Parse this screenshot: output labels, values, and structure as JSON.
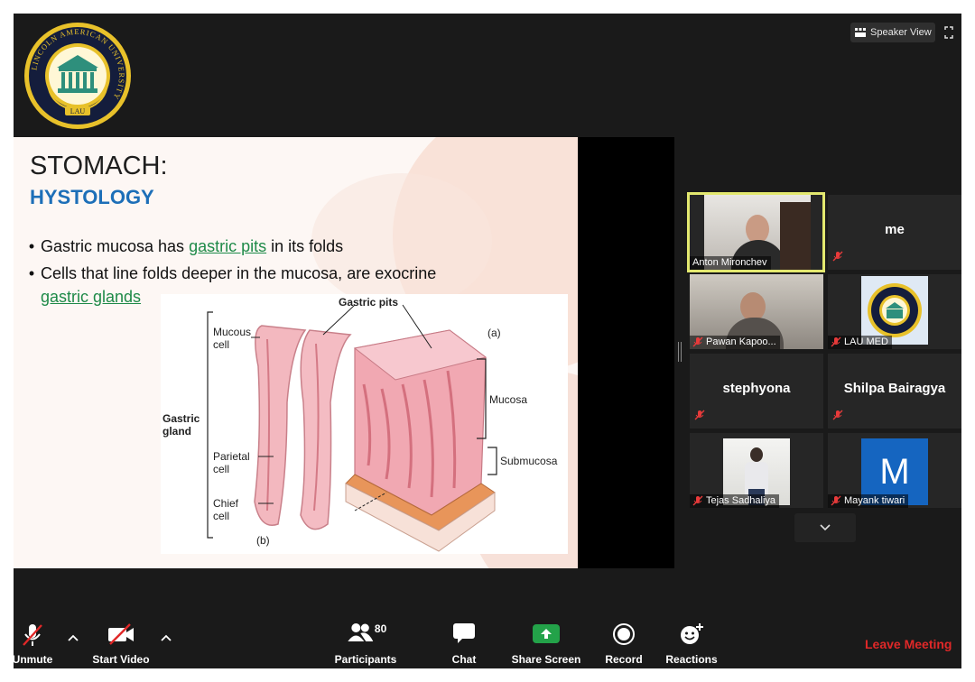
{
  "logo": {
    "ring_text": "LINCOLN AMERICAN UNIVERSITY",
    "abbrev": "LAU"
  },
  "top_bar": {
    "speaker_view_label": "Speaker View",
    "speaker_view_icon": "grid-view-icon",
    "fullscreen_icon": "fullscreen-icon"
  },
  "slide": {
    "title": "STOMACH:",
    "subtitle": "HYSTOLOGY",
    "bullets": [
      {
        "pre": "Gastric mucosa has ",
        "link": "gastric pits",
        "post": " in its folds"
      },
      {
        "line1": "Cells that line folds deeper in the mucosa, are exocrine",
        "link": "gastric glands"
      }
    ],
    "figure": {
      "labels": {
        "gastric_pits": "Gastric pits",
        "part_a": "(a)",
        "part_b": "(b)",
        "mucous_cell_1": "Mucous",
        "mucous_cell_2": "cell",
        "gastric_gland_1": "Gastric",
        "gastric_gland_2": "gland",
        "parietal_1": "Parietal",
        "parietal_2": "cell",
        "chief_1": "Chief",
        "chief_2": "cell",
        "mucosa": "Mucosa",
        "submucosa": "Submucosa"
      }
    }
  },
  "participants": [
    {
      "name": "Anton Mironchev",
      "type": "video",
      "active": true
    },
    {
      "name": "me",
      "type": "name-only",
      "muted": true
    },
    {
      "name": "Pawan Kapoo...",
      "type": "video",
      "muted": true
    },
    {
      "name": "LAU MED",
      "type": "logo",
      "muted": true
    },
    {
      "name": "stephyona",
      "type": "name-only",
      "muted": true
    },
    {
      "name": "Shilpa Bairagya",
      "type": "name-only",
      "muted": true
    },
    {
      "name": "Tejas Sadhaliya",
      "type": "photo",
      "muted": true
    },
    {
      "name": "Mayank tiwari",
      "type": "avatar",
      "avatar_letter": "M",
      "avatar_color": "#1565c0",
      "muted": true
    }
  ],
  "toolbar": {
    "unmute": "Unmute",
    "start_video": "Start Video",
    "participants": "Participants",
    "participants_count": "80",
    "chat": "Chat",
    "share_screen": "Share Screen",
    "record": "Record",
    "reactions": "Reactions",
    "leave": "Leave Meeting",
    "share_color": "#23a249",
    "leave_color": "#e02828"
  },
  "colors": {
    "active_speaker_border": "#e3e86f",
    "title_blue": "#1d6fb8",
    "link_green": "#1e8a48"
  }
}
